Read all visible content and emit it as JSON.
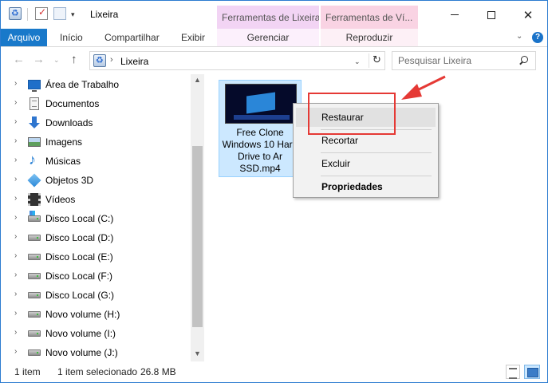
{
  "window": {
    "title": "Lixeira",
    "tool_tabs": [
      "Ferramentas de Lixeira",
      "Ferramentas de Ví..."
    ]
  },
  "quick_access": {
    "dropdown_glyph": "▾"
  },
  "window_buttons": {
    "close_glyph": "✕"
  },
  "ribbon": {
    "tabs": [
      "Arquivo",
      "Início",
      "Compartilhar",
      "Exibir",
      "Gerenciar",
      "Reproduzir"
    ],
    "collapse_glyph": "⌄",
    "help_glyph": "?"
  },
  "navbar": {
    "back_glyph": "←",
    "forward_glyph": "→",
    "dropdown_glyph": "⌄",
    "up_glyph": "↑",
    "address": "Lixeira",
    "address_separator": "›",
    "address_dropdown_glyph": "⌄",
    "refresh_glyph": "↻",
    "search_placeholder": "Pesquisar Lixeira"
  },
  "sidebar": {
    "chevron_glyph": "›",
    "items": [
      {
        "label": "Área de Trabalho",
        "icon": "desktop-icon"
      },
      {
        "label": "Documentos",
        "icon": "documents-icon"
      },
      {
        "label": "Downloads",
        "icon": "downloads-icon"
      },
      {
        "label": "Imagens",
        "icon": "pictures-icon"
      },
      {
        "label": "Músicas",
        "icon": "music-icon"
      },
      {
        "label": "Objetos 3D",
        "icon": "objects-3d-icon"
      },
      {
        "label": "Vídeos",
        "icon": "videos-icon"
      },
      {
        "label": "Disco Local (C:)",
        "icon": "system-drive-icon"
      },
      {
        "label": "Disco Local (D:)",
        "icon": "drive-icon"
      },
      {
        "label": "Disco Local (E:)",
        "icon": "drive-icon"
      },
      {
        "label": "Disco Local (F:)",
        "icon": "drive-icon"
      },
      {
        "label": "Disco Local (G:)",
        "icon": "drive-icon"
      },
      {
        "label": "Novo volume (H:)",
        "icon": "drive-icon"
      },
      {
        "label": "Novo volume (I:)",
        "icon": "drive-icon"
      },
      {
        "label": "Novo volume (J:)",
        "icon": "drive-icon"
      }
    ],
    "scroll_up_glyph": "▲",
    "scroll_down_glyph": "▼"
  },
  "content": {
    "files": [
      {
        "name": "Free Clone Windows 10 Hard Drive to Ar SSD.mp4",
        "type": "video"
      }
    ]
  },
  "context_menu": {
    "items": [
      {
        "label": "Restaurar",
        "highlighted": true
      },
      {
        "label": "Recortar"
      },
      {
        "label": "Excluir"
      },
      {
        "label": "Propriedades",
        "bold": true
      }
    ]
  },
  "status": {
    "item_count": "1 item",
    "selected": "1 item selecionado",
    "size": "26.8 MB"
  },
  "colors": {
    "accent": "#1979ca",
    "selection": "#cce8ff",
    "annotation_red": "#e53935",
    "tool_tab_lixeira": "#f2d4f4",
    "tool_tab_video": "#f9d3e3"
  }
}
